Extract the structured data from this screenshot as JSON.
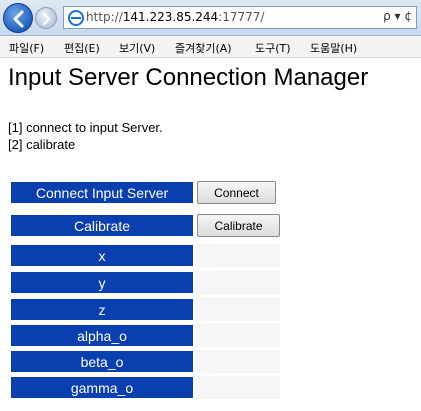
{
  "browser": {
    "url_prefix": "http://",
    "url_host": "141.223.85.244",
    "url_suffix": ":17777/",
    "url_controls": "ρ ▾ ¢"
  },
  "menu": {
    "items": [
      "파일(F)",
      "편집(E)",
      "보기(V)",
      "즐겨찾기(A)",
      "도구(T)",
      "도움말(H)"
    ]
  },
  "page": {
    "title": "Input Server Connection Manager",
    "option1": "[1] connect to input Server.",
    "option2": "[2] calibrate"
  },
  "rows": {
    "connect": {
      "label": "Connect Input Server",
      "button": "Connect"
    },
    "calibrate": {
      "label": "Calibrate",
      "button": "Calibrate"
    },
    "x": {
      "label": "x"
    },
    "y": {
      "label": "y"
    },
    "z": {
      "label": "z"
    },
    "alpha": {
      "label": "alpha_o"
    },
    "beta": {
      "label": "beta_o"
    },
    "gamma": {
      "label": "gamma_o"
    }
  },
  "colors": {
    "label_bg": "#0a3fb0",
    "label_text": "#ffffff"
  }
}
